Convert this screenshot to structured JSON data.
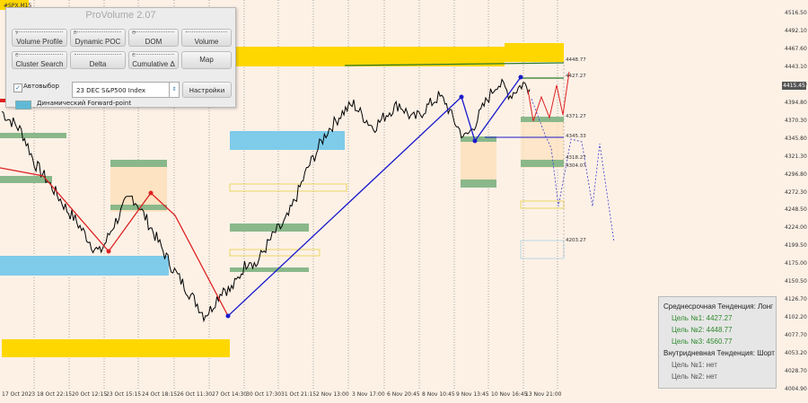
{
  "symbol": "#SPX.M15",
  "panel": {
    "title": "ProVolume 2.07",
    "buttons": [
      {
        "key": "V",
        "label": "Volume Profile",
        "bars": true
      },
      {
        "key": "D",
        "label": "Dynamic POC",
        "bars": true
      },
      {
        "key": "O",
        "label": "DOM",
        "bars": true
      },
      {
        "key": "",
        "label": "Volume",
        "bars": true
      },
      {
        "key": "C",
        "label": "Cluster Search",
        "bars": true
      },
      {
        "key": "",
        "label": "Delta",
        "bars": true
      },
      {
        "key": "C",
        "label": "Cumulative Δ",
        "bars": true
      },
      {
        "key": "",
        "label": "Map",
        "bars": false
      }
    ],
    "auto_label": "Автовыбор",
    "auto_checked": "✓",
    "instrument": "23 DEC S&P500 Index",
    "settings_label": "Настройки",
    "forward_point_label": "Динамический Forward-point"
  },
  "price_axis": [
    "4516.50",
    "4492.10",
    "4467.60",
    "4443.10",
    "4418.60",
    "4394.80",
    "4370.30",
    "4345.80",
    "4321.30",
    "4296.80",
    "4272.30",
    "4248.50",
    "4224.00",
    "4199.50",
    "4175.00",
    "4150.50",
    "4126.70",
    "4102.20",
    "4077.70",
    "4053.20",
    "4028.70",
    "4004.90"
  ],
  "current_price": "4415.45",
  "level_labels": [
    "4448.77",
    "4427.27",
    "4371.27",
    "4345.33",
    "4318.27",
    "4304.07",
    "4203.27"
  ],
  "date_axis": [
    "17 Oct 2023",
    "18 Oct 22:15",
    "20 Oct 12:15",
    "23 Oct 15:15",
    "24 Oct 18:15",
    "26 Oct 11:30",
    "27 Oct 14:30",
    "30 Oct 17:30",
    "31 Oct 21:15",
    "2 Nov 13:00",
    "3 Nov 17:00",
    "6 Nov 20:45",
    "8 Nov 10:45",
    "9 Nov 13:45",
    "10 Nov 16:45",
    "13 Nov 21:00"
  ],
  "trend": {
    "medium_title": "Среднесрочная Тенденция: Лонг",
    "targets_long": [
      "Цель №1: 4427.27",
      "Цель №2: 4448.77",
      "Цель №3: 4560.77"
    ],
    "intraday_title": "Внутридневная Тенденция: Шорт",
    "targets_short": [
      "Цель №1: нет",
      "Цель №2: нет"
    ]
  },
  "colors": {
    "background": "#fdf1e6",
    "price_line": "#000000",
    "zone_gold": "#ffd700",
    "zone_blue": "#7ecbea",
    "zone_green": "#8ab88a",
    "zone_peach": "#fde3c2",
    "trend_red": "#dd2222",
    "trend_blue": "#1a1acc",
    "target_green": "#2e8a2e"
  },
  "chart_data": {
    "type": "line",
    "series": [
      {
        "values": [
          4382,
          4372,
          4365,
          4355,
          4335,
          4312,
          4300,
          4288,
          4275,
          4262,
          4248,
          4238,
          4225,
          4212,
          4198,
          4190,
          4205,
          4225,
          4240,
          4258,
          4266,
          4254,
          4238,
          4222,
          4205,
          4188,
          4172,
          4158,
          4145,
          4132,
          4120,
          4105,
          4112,
          4128,
          4142,
          4138,
          4150,
          4168,
          4182,
          4172,
          4190,
          4204,
          4218,
          4226,
          4240,
          4262,
          4284,
          4306,
          4322,
          4340,
          4356,
          4366,
          4378,
          4386,
          4392,
          4380,
          4370,
          4360,
          4368,
          4378,
          4386,
          4392,
          4382,
          4372,
          4376,
          4386,
          4394,
          4402,
          4396,
          4376,
          4360,
          4346,
          4356,
          4372,
          4390,
          4406,
          4420,
          4416,
          4404,
          4412,
          4420,
          4412
        ]
      }
    ]
  }
}
